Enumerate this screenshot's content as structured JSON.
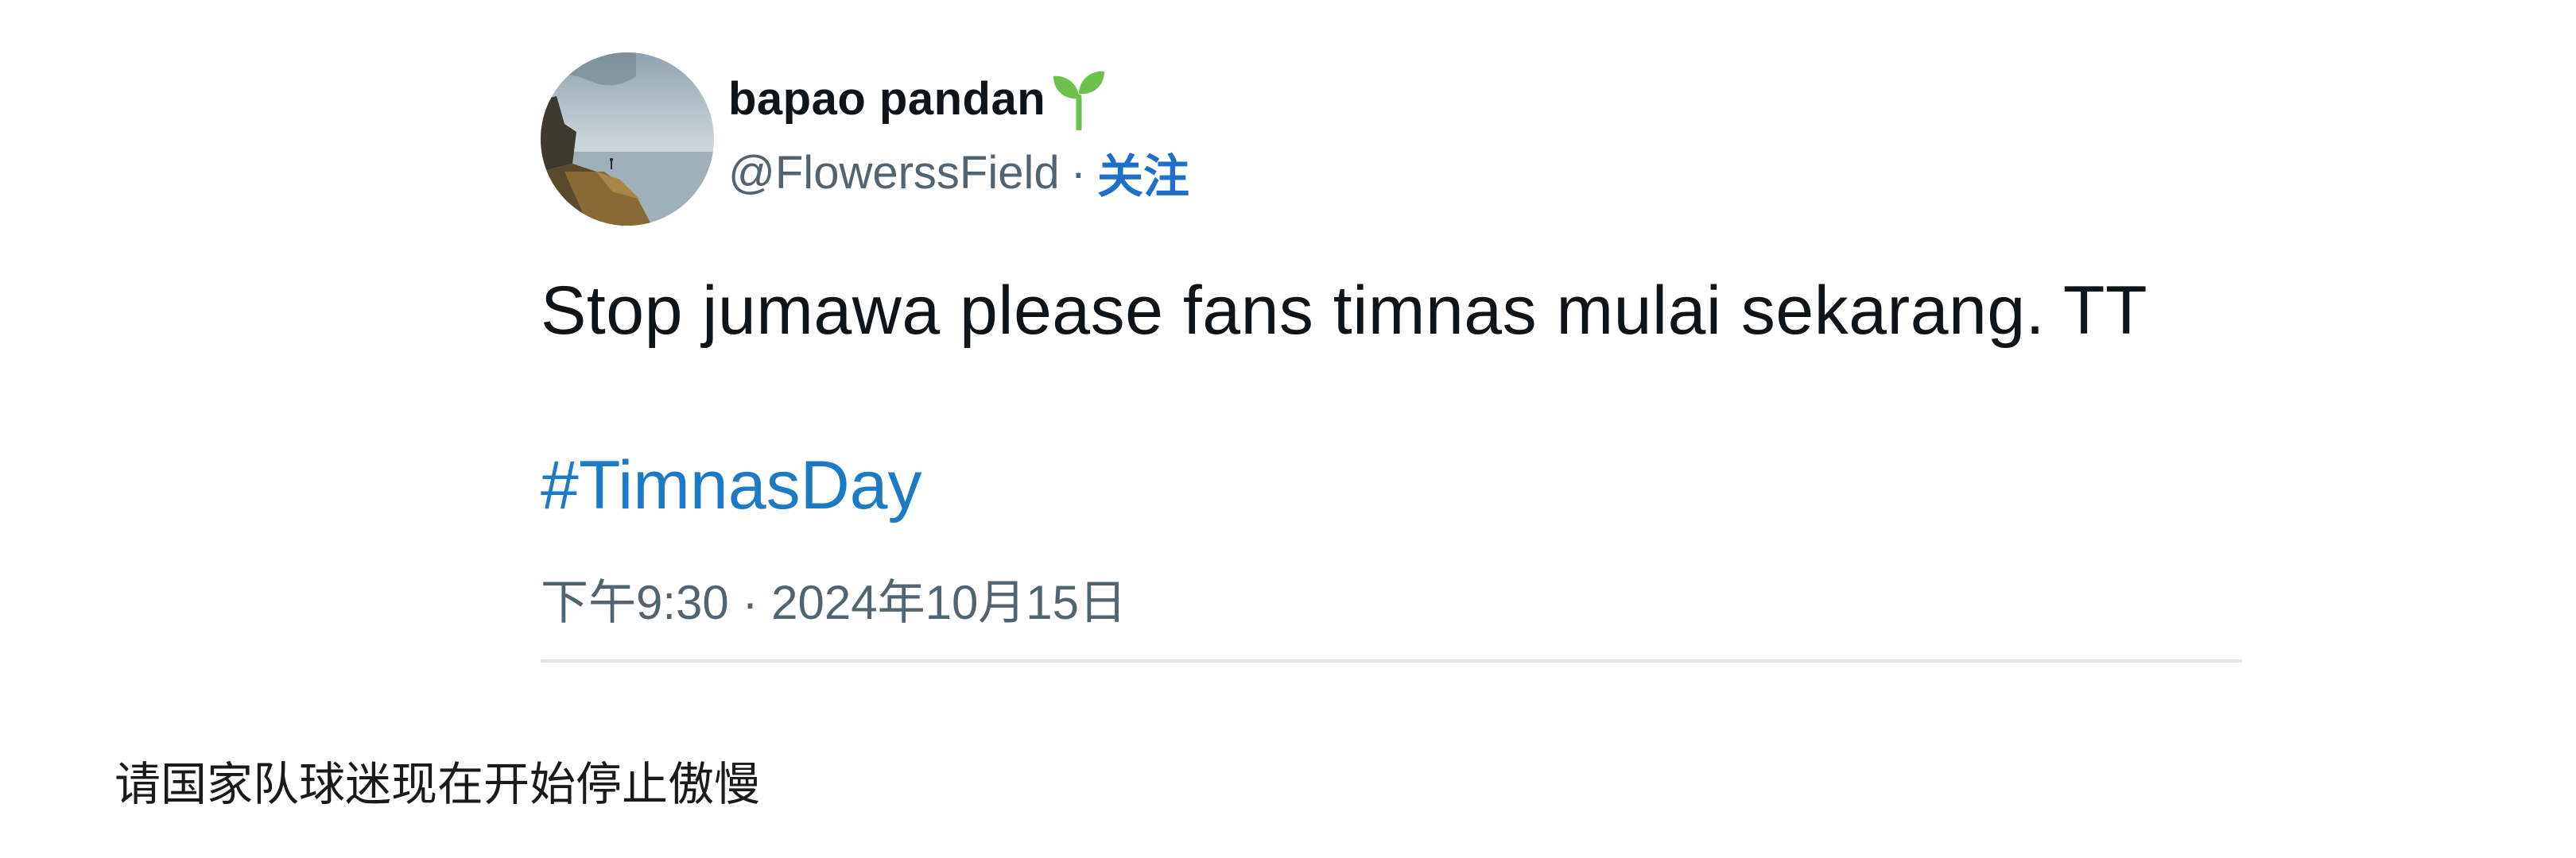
{
  "tweet": {
    "author": {
      "display_name": "bapao pandan",
      "name_emoji_icon": "seedling-icon",
      "handle": "@FlowerssField",
      "separator": "·",
      "follow_label": "关注"
    },
    "text": "Stop jumawa please fans timnas mulai sekarang. TT",
    "hashtag": "#TimnasDay",
    "timestamp": "下午9:30 · 2024年10月15日"
  },
  "translation": "请国家队球迷现在开始停止傲慢",
  "colors": {
    "link": "#1d7bc6",
    "follow": "#1d6fc9",
    "secondary_text": "#536471",
    "primary_text": "#0f1419",
    "sprout_green": "#6cc24a"
  }
}
